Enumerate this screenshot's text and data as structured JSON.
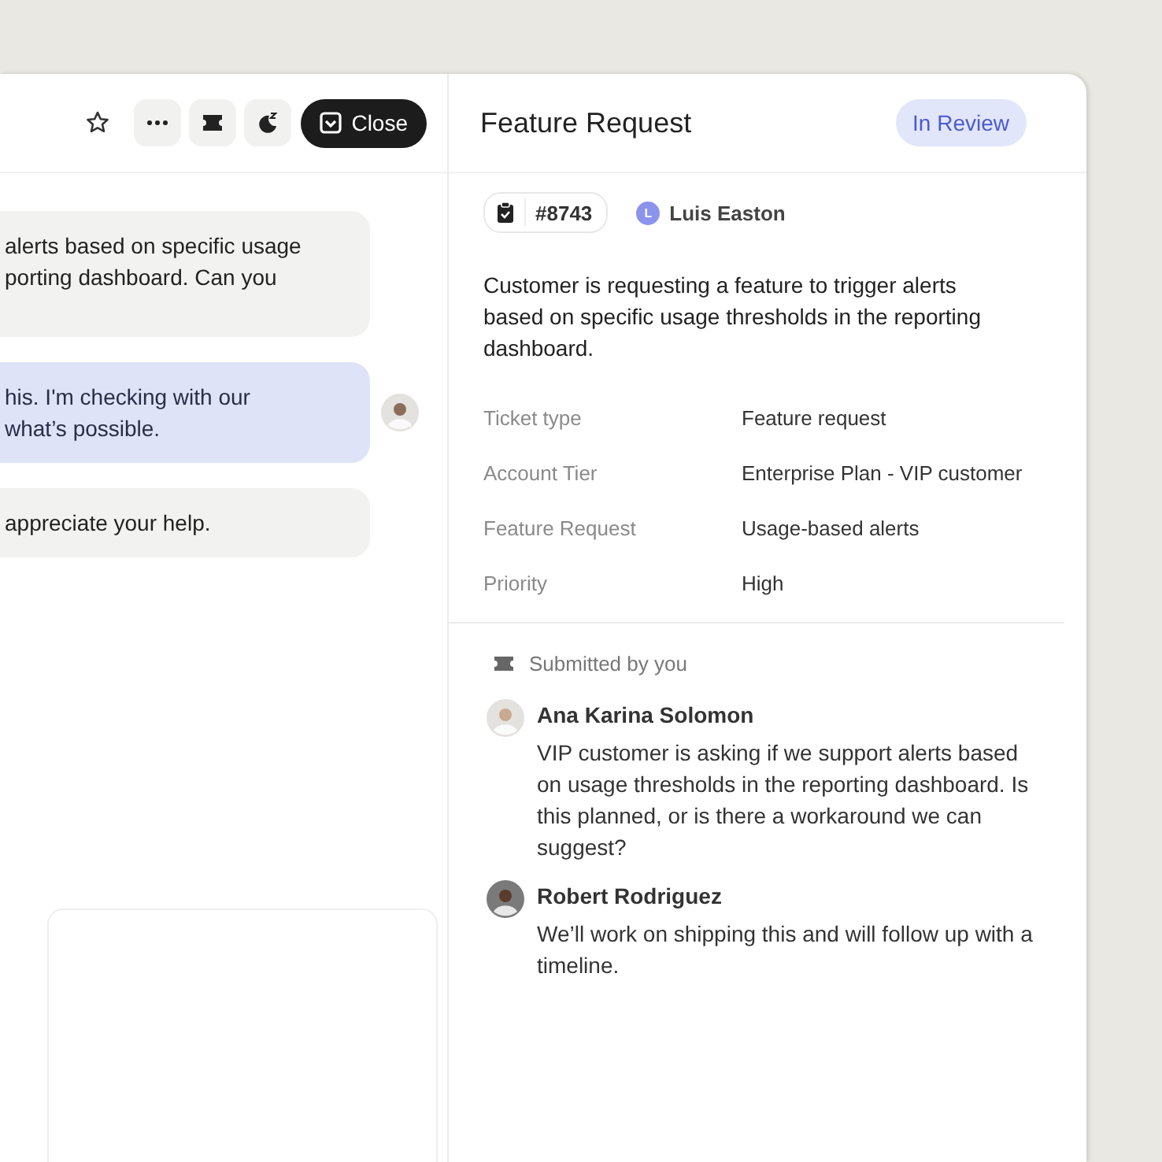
{
  "toolbar": {
    "close_button": "Close"
  },
  "header": {
    "title": "Feature Request",
    "status": "In Review"
  },
  "chat": {
    "messages": [
      {
        "kind": "incoming",
        "lines": [
          "alerts based on specific usage",
          "porting dashboard. Can you"
        ]
      },
      {
        "kind": "outgoing",
        "lines": [
          "his. I'm checking with our",
          "what’s possible."
        ]
      },
      {
        "kind": "incoming",
        "lines": [
          "appreciate your help."
        ]
      }
    ]
  },
  "ticket": {
    "number": "#8743",
    "assignee": {
      "initial": "L",
      "name": "Luis Easton"
    },
    "description": "Customer is requesting a feature to trigger alerts based on specific usage thresholds in the reporting dashboard.",
    "fields": [
      {
        "label": "Ticket type",
        "value": "Feature request"
      },
      {
        "label": "Account Tier",
        "value": "Enterprise Plan - VIP customer"
      },
      {
        "label": "Feature Request",
        "value": "Usage-based alerts"
      },
      {
        "label": "Priority",
        "value": "High"
      }
    ]
  },
  "activity": {
    "label": "Submitted by you",
    "comments": [
      {
        "author": "Ana Karina Solomon",
        "text": "VIP customer is asking if we support alerts based on usage thresholds in the reporting dashboard. Is this planned, or is there a workaround we can suggest?"
      },
      {
        "author": "Robert Rodriguez",
        "text": "We’ll work on shipping this and will follow up with a timeline."
      }
    ]
  }
}
